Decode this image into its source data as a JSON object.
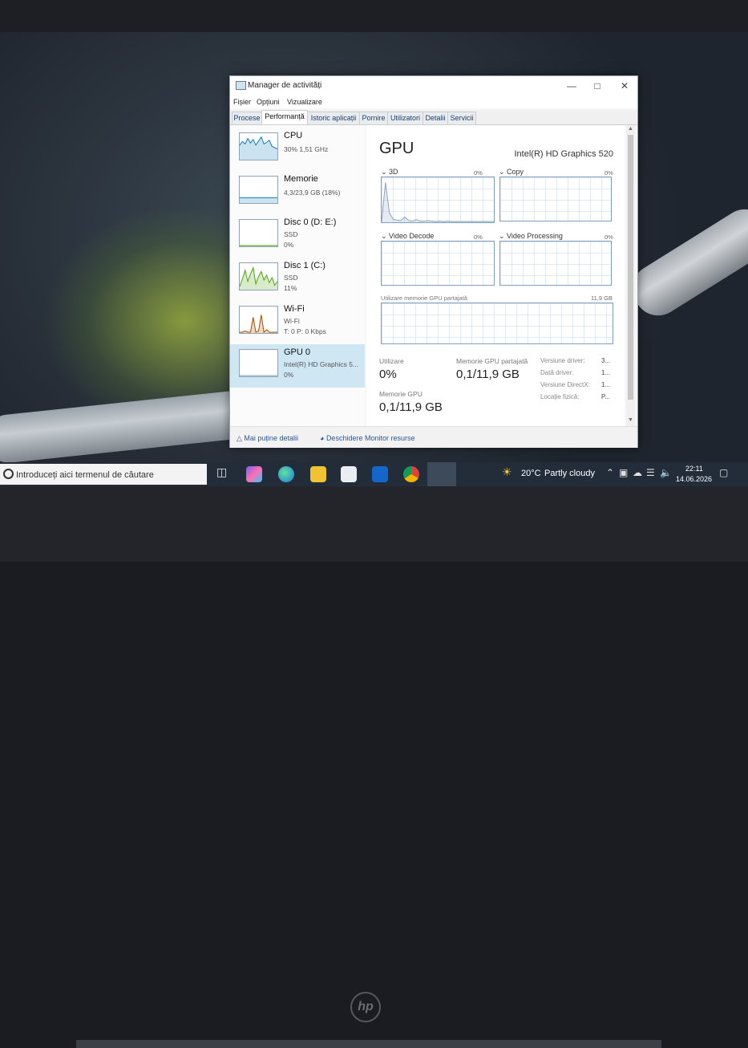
{
  "window": {
    "title": "Manager de activități",
    "menu": [
      "Fișier",
      "Opțiuni",
      "Vizualizare"
    ],
    "tabs": [
      "Procese",
      "Performanță",
      "Istoric aplicații",
      "Pornire",
      "Utilizatori",
      "Detalii",
      "Servicii"
    ],
    "active_tab": "Performanță"
  },
  "resources": [
    {
      "name": "CPU",
      "line1": "30%  1,51 GHz",
      "line2": ""
    },
    {
      "name": "Memorie",
      "line1": "4,3/23,9 GB (18%)",
      "line2": ""
    },
    {
      "name": "Disc 0 (D: E:)",
      "line1": "SSD",
      "line2": "0%"
    },
    {
      "name": "Disc 1 (C:)",
      "line1": "SSD",
      "line2": "11%"
    },
    {
      "name": "Wi-Fi",
      "line1": "Wi-Fi",
      "line2": "T: 0  P: 0 Kbps"
    },
    {
      "name": "GPU 0",
      "line1": "Intel(R) HD Graphics 5...",
      "line2": "0%"
    }
  ],
  "selected_resource": "GPU 0",
  "gpu": {
    "title": "GPU",
    "model": "Intel(R) HD Graphics 520",
    "engines": [
      {
        "label": "3D",
        "pct": "0%"
      },
      {
        "label": "Copy",
        "pct": "0%"
      },
      {
        "label": "Video Decode",
        "pct": "0%"
      },
      {
        "label": "Video Processing",
        "pct": "0%"
      }
    ],
    "shared_mem_label": "Utilizare memorie GPU partajată",
    "shared_mem_max": "11,9 GB",
    "stats": {
      "utilization_label": "Utilizare",
      "utilization_value": "0%",
      "shared_label": "Memorie GPU partajată",
      "shared_value": "0,1/11,9 GB",
      "gpu_mem_label": "Memorie GPU",
      "gpu_mem_value": "0,1/11,9 GB"
    },
    "info": [
      {
        "label": "Versiune driver:",
        "value": "3..."
      },
      {
        "label": "Dată driver:",
        "value": "1..."
      },
      {
        "label": "Versiune DirectX:",
        "value": "1..."
      },
      {
        "label": "Locație fizică:",
        "value": "P..."
      }
    ]
  },
  "footer": {
    "fewer_details": "Mai puține detalii",
    "resource_monitor": "Deschidere Monitor resurse"
  },
  "taskbar": {
    "search_placeholder": "Introduceți aici termenul de căutare",
    "weather_temp": "20°C",
    "weather_desc": "Partly cloudy",
    "time": "22:11",
    "date": "14.06.2026"
  },
  "colors": {
    "accent": "#1e6ec8",
    "cpu_graph": "#117dbb",
    "disk_graph": "#4da60c",
    "wifi_graph": "#a74f01",
    "gpu_graph": "#8aa4c0",
    "selected_bg": "#cfe7f3"
  },
  "sparklines": {
    "cpu": [
      55,
      70,
      60,
      82,
      64,
      78,
      55,
      72,
      88,
      60,
      66,
      75,
      50,
      45,
      40
    ],
    "memory": [
      18,
      18,
      18,
      18,
      18,
      18,
      18,
      18,
      18,
      18,
      18,
      18,
      18,
      18,
      18
    ],
    "disk0": [
      0,
      0,
      0,
      0,
      0,
      0,
      0,
      0,
      0,
      0,
      0,
      0,
      0,
      0,
      0
    ],
    "disk1": [
      10,
      40,
      75,
      30,
      60,
      85,
      20,
      50,
      70,
      35,
      55,
      25,
      45,
      15,
      30
    ],
    "wifi": [
      0,
      0,
      5,
      0,
      0,
      60,
      0,
      5,
      70,
      0,
      10,
      0,
      0,
      0,
      0
    ],
    "gpu": [
      0,
      0,
      0,
      0,
      0,
      0,
      0,
      0,
      0,
      0,
      0,
      0,
      0,
      0,
      0
    ],
    "gpu_3d": [
      0,
      90,
      20,
      5,
      3,
      2,
      10,
      2,
      1,
      4,
      1,
      1,
      2,
      1,
      0,
      1,
      0,
      1,
      0,
      0,
      0,
      0,
      0,
      0,
      0,
      0,
      0,
      0,
      0,
      0
    ]
  }
}
